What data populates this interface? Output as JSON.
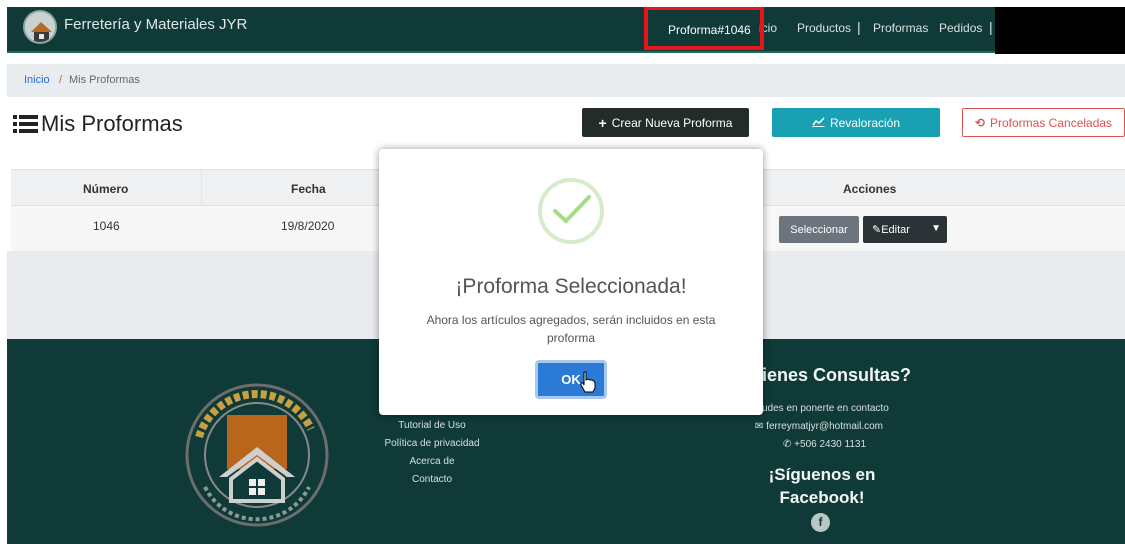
{
  "navbar": {
    "brand": "Ferretería y Materiales JYR",
    "active_proforma": "Proforma#1046",
    "items": [
      "icio",
      "Productos",
      "|",
      "Proformas",
      "Pedidos",
      "|"
    ]
  },
  "breadcrumb": {
    "home": "Inicio",
    "separator": "/",
    "current": "Mis Proformas"
  },
  "page": {
    "title": "Mis Proformas",
    "buttons": {
      "new": "Crear Nueva Proforma",
      "revaluation": "Revaloración",
      "cancelled": "Proformas Canceladas"
    }
  },
  "table": {
    "headers": {
      "number": "Número",
      "date": "Fecha",
      "actions": "Acciones"
    },
    "rows": [
      {
        "number": "1046",
        "date": "19/8/2020",
        "select": "Seleccionar",
        "edit": "Editar"
      }
    ]
  },
  "footer": {
    "links": [
      "Tutorial de Uso",
      "Política de privacidad",
      "Acerca de",
      "Contacto"
    ],
    "contact_title": "ienes Consultas?",
    "contact_subtitle": "udes en ponerte en contacto",
    "email": "ferreymatjyr@hotmail.com",
    "phone": "+506 2430 1131",
    "follow_title": "¡Síguenos en Facebook!",
    "fb_letter": "f"
  },
  "modal": {
    "title": "¡Proforma Seleccionada!",
    "text": "Ahora los artículos agregados, serán incluidos en esta proforma",
    "ok": "OK"
  },
  "colors": {
    "navbar": "#0f3a38",
    "highlight_border": "#e8161b",
    "ok_button": "#2b7bd6",
    "success_check": "#a5dc86"
  },
  "icons": [
    "list-icon",
    "plus-icon",
    "chart-icon",
    "undo-icon",
    "edit-icon",
    "caret-down-icon",
    "envelope-icon",
    "phone-icon",
    "facebook-icon",
    "success-check-icon",
    "hand-cursor-icon"
  ]
}
